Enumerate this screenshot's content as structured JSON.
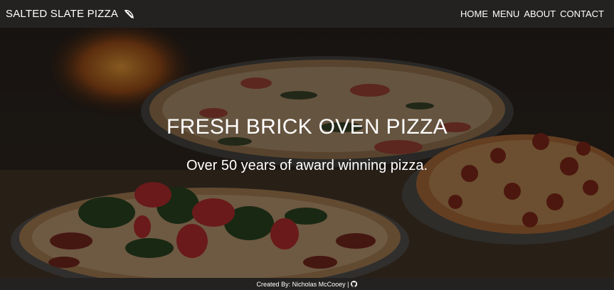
{
  "brand": {
    "name": "SALTED SLATE PIZZA",
    "icon": "pizza-slice-icon"
  },
  "nav": {
    "items": [
      {
        "label": "HOME"
      },
      {
        "label": "MENU"
      },
      {
        "label": "ABOUT"
      },
      {
        "label": "CONTACT"
      }
    ]
  },
  "hero": {
    "title": "FRESH BRICK OVEN PIZZA",
    "subtitle": "Over 50 years of award winning pizza."
  },
  "footer": {
    "credit": "Created By: Nicholas McCooey |",
    "icon": "github-icon"
  },
  "colors": {
    "navbar": "#232221",
    "text": "#ffffff"
  }
}
